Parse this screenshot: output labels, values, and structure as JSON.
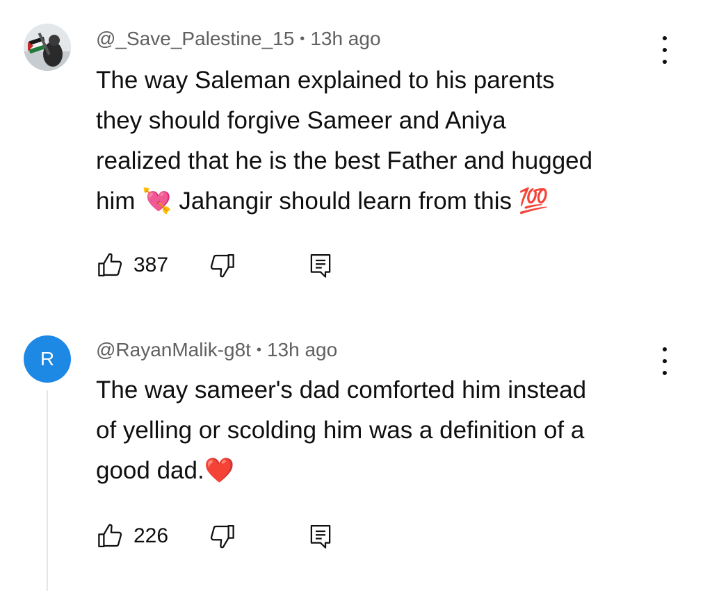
{
  "comments": [
    {
      "handle": "@_Save_Palestine_15",
      "time": "13h ago",
      "separator": "•",
      "text": "The way Saleman explained to his parents\nthey should forgive Sameer and Aniya\nrealized that he is the best Father and hugged\nhim 💘 Jahangir should learn from this 💯",
      "likes": "387",
      "avatar": "photo"
    },
    {
      "handle": "@RayanMalik-g8t",
      "time": "13h ago",
      "separator": "•",
      "text": "The way sameer's dad comforted him instead\nof yelling or scolding him was a definition of a\ngood dad.❤️",
      "likes": "226",
      "avatar_letter": "R",
      "avatar_color": "#1e88e5"
    }
  ],
  "icons": {
    "like": "thumbs-up-icon",
    "dislike": "thumbs-down-icon",
    "reply": "reply-comment-icon",
    "more": "more-vert-icon"
  }
}
